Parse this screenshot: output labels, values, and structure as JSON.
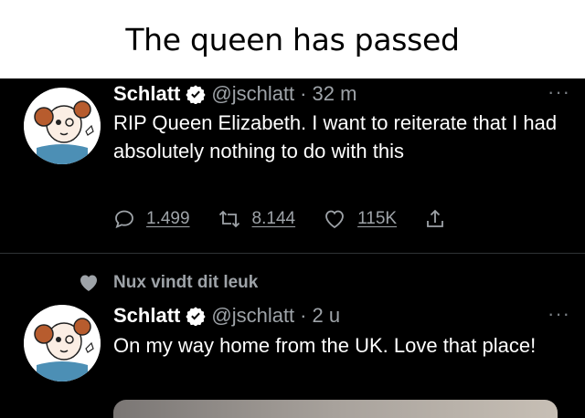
{
  "caption": "The queen has passed",
  "tweets": [
    {
      "name": "Schlatt",
      "handle": "@jschlatt",
      "separator": "·",
      "time": "32 m",
      "text": "RIP Queen Elizabeth. I want to reiterate that I had absolutely nothing to do with this",
      "actions": {
        "replies": "1.499",
        "retweets": "8.144",
        "likes": "115K"
      }
    },
    {
      "liked_by": "Nux vindt dit leuk",
      "name": "Schlatt",
      "handle": "@jschlatt",
      "separator": "·",
      "time": "2 u",
      "text": "On my way home from the UK. Love that place!"
    }
  ],
  "more_symbol": "···",
  "icons": [
    "verified-badge-icon",
    "reply-icon",
    "retweet-icon",
    "like-icon",
    "share-icon",
    "heart-icon",
    "more-icon"
  ],
  "colors": {
    "background": "#000000",
    "secondary_text": "#9ea3a8",
    "avatar_ring": "#ffffff"
  }
}
